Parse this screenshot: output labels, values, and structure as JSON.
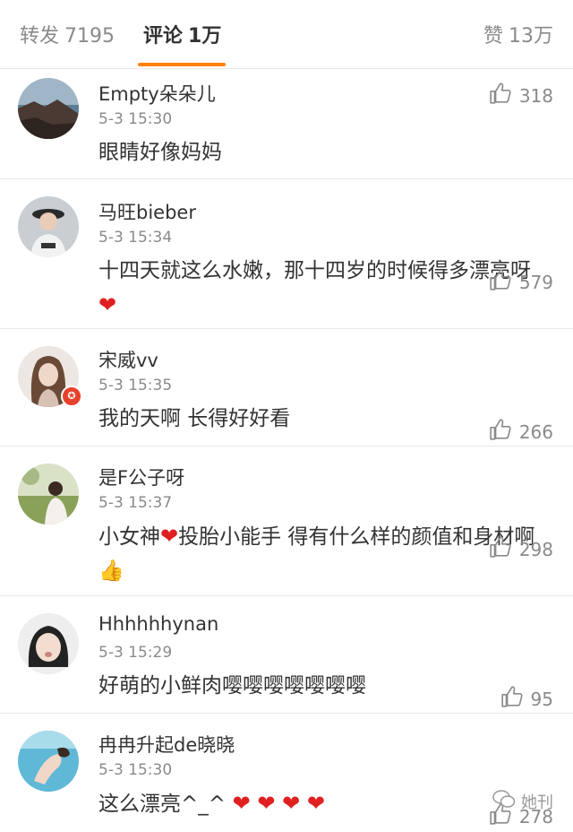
{
  "tabs": {
    "repost": {
      "label": "转发",
      "count": "7195"
    },
    "comment": {
      "label": "评论",
      "count": "1万"
    },
    "like": {
      "label": "赞",
      "count": "13万"
    }
  },
  "comments": [
    {
      "user": "Empty朵朵儿",
      "time": "5-3 15:30",
      "text": "眼睛好像妈妈",
      "likes": "318",
      "avatar_icon": "seaside-photo-avatar"
    },
    {
      "user": "马旺bieber",
      "time": "5-3 15:34",
      "text": "十四天就这么水嫩，那十四岁的时候得多漂亮呀",
      "likes": "579",
      "avatar_icon": "hat-girl-avatar",
      "emoji": "❤"
    },
    {
      "user": "宋威vv",
      "time": "5-3 15:35",
      "text": "我的天啊 长得好好看",
      "likes": "266",
      "avatar_icon": "long-hair-girl-avatar",
      "verified": true
    },
    {
      "user": "是F公子呀",
      "time": "5-3 15:37",
      "text_parts": [
        "小女神",
        "投胎小能手 得有什么样的颜值和身材啊"
      ],
      "likes": "298",
      "avatar_icon": "outdoor-girl-avatar"
    },
    {
      "user": "Hhhhhhynan",
      "time": "5-3 15:29",
      "text": "好萌的小鲜肉嘤嘤嘤嘤嘤嘤嘤",
      "likes": "95",
      "avatar_icon": "cute-face-avatar"
    },
    {
      "user": "冉冉升起de晓晓",
      "time": "5-3 15:30",
      "text": "这么漂亮^_^",
      "likes": "278",
      "avatar_icon": "underwater-avatar"
    }
  ],
  "watermark": {
    "text": "她刊"
  },
  "colors": {
    "accent": "#ff8200",
    "heart": "#e02020",
    "muted": "#8a8a8a"
  }
}
